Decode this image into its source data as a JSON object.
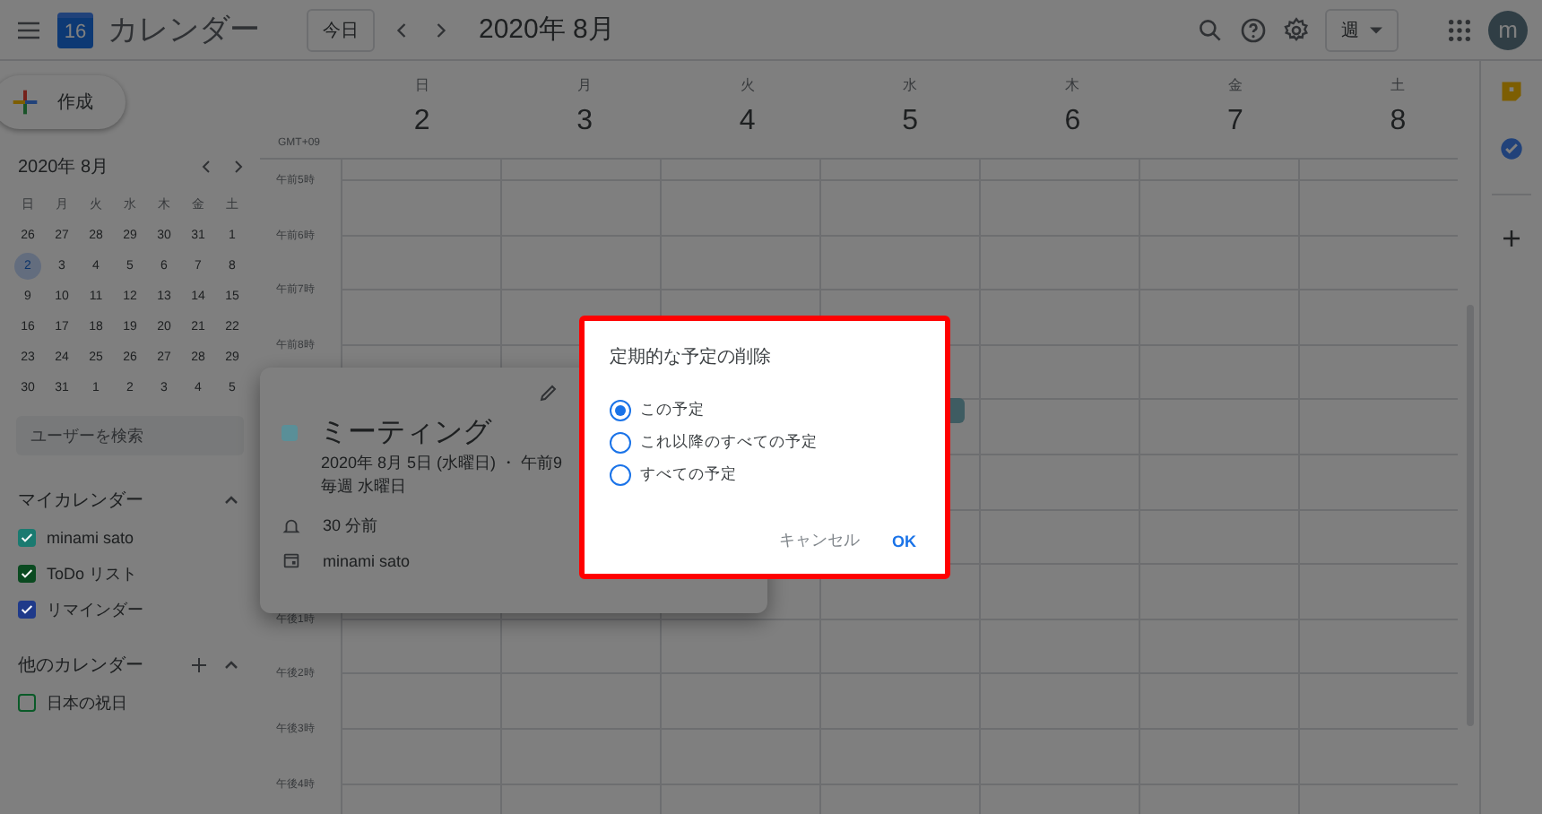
{
  "header": {
    "app_logo_day": "16",
    "app_name": "カレンダー",
    "today_button": "今日",
    "current_period": "2020年 8月",
    "view_selector": "週",
    "avatar_initial": "m"
  },
  "create_button": "作成",
  "mini_calendar": {
    "title": "2020年 8月",
    "weekdays": [
      "日",
      "月",
      "火",
      "水",
      "木",
      "金",
      "土"
    ],
    "weeks": [
      [
        {
          "day": "26",
          "selected": false
        },
        {
          "day": "27",
          "selected": false
        },
        {
          "day": "28",
          "selected": false
        },
        {
          "day": "29",
          "selected": false
        },
        {
          "day": "30",
          "selected": false
        },
        {
          "day": "31",
          "selected": false
        },
        {
          "day": "1",
          "selected": false
        }
      ],
      [
        {
          "day": "2",
          "selected": true
        },
        {
          "day": "3",
          "selected": false
        },
        {
          "day": "4",
          "selected": false
        },
        {
          "day": "5",
          "selected": false
        },
        {
          "day": "6",
          "selected": false
        },
        {
          "day": "7",
          "selected": false
        },
        {
          "day": "8",
          "selected": false
        }
      ],
      [
        {
          "day": "9",
          "selected": false
        },
        {
          "day": "10",
          "selected": false
        },
        {
          "day": "11",
          "selected": false
        },
        {
          "day": "12",
          "selected": false
        },
        {
          "day": "13",
          "selected": false
        },
        {
          "day": "14",
          "selected": false
        },
        {
          "day": "15",
          "selected": false
        }
      ],
      [
        {
          "day": "16",
          "selected": false
        },
        {
          "day": "17",
          "selected": false
        },
        {
          "day": "18",
          "selected": false
        },
        {
          "day": "19",
          "selected": false
        },
        {
          "day": "20",
          "selected": false
        },
        {
          "day": "21",
          "selected": false
        },
        {
          "day": "22",
          "selected": false
        }
      ],
      [
        {
          "day": "23",
          "selected": false
        },
        {
          "day": "24",
          "selected": false
        },
        {
          "day": "25",
          "selected": false
        },
        {
          "day": "26",
          "selected": false
        },
        {
          "day": "27",
          "selected": false
        },
        {
          "day": "28",
          "selected": false
        },
        {
          "day": "29",
          "selected": false
        }
      ],
      [
        {
          "day": "30",
          "selected": false
        },
        {
          "day": "31",
          "selected": false
        },
        {
          "day": "1",
          "selected": false
        },
        {
          "day": "2",
          "selected": false
        },
        {
          "day": "3",
          "selected": false
        },
        {
          "day": "4",
          "selected": false
        },
        {
          "day": "5",
          "selected": false
        }
      ]
    ]
  },
  "people_search": {
    "placeholder": "ユーザーを検索"
  },
  "my_calendars": {
    "title": "マイカレンダー",
    "items": [
      {
        "name": "minami sato",
        "checked": true,
        "color": "#1a7a70"
      },
      {
        "name": "ToDo リスト",
        "checked": true,
        "color": "#0a4a20"
      },
      {
        "name": "リマインダー",
        "checked": true,
        "color": "#1f3a8a"
      }
    ]
  },
  "other_calendars": {
    "title": "他のカレンダー",
    "items": [
      {
        "name": "日本の祝日",
        "checked": false,
        "color": "#0a5a28"
      }
    ]
  },
  "week": {
    "timezone": "GMT+09",
    "days": [
      {
        "weekday": "日",
        "date": "2"
      },
      {
        "weekday": "月",
        "date": "3"
      },
      {
        "weekday": "火",
        "date": "4"
      },
      {
        "weekday": "水",
        "date": "5"
      },
      {
        "weekday": "木",
        "date": "6"
      },
      {
        "weekday": "金",
        "date": "7"
      },
      {
        "weekday": "土",
        "date": "8"
      }
    ],
    "morning_hours": [
      "午前5時",
      "午前6時",
      "午前7時",
      "午前8時"
    ],
    "afternoon_hours": [
      "午後1時",
      "午後2時",
      "午後3時",
      "午後4時"
    ]
  },
  "event_popup": {
    "color": "#5a8f98",
    "title": "ミーティング",
    "date_line": "2020年 8月 5日 (水曜日) ・ 午前9",
    "recurrence": "毎週 水曜日",
    "reminder": "30 分前",
    "calendar": "minami sato"
  },
  "dialog": {
    "title": "定期的な予定の削除",
    "options": [
      {
        "label": "この予定",
        "selected": true
      },
      {
        "label": "これ以降のすべての予定",
        "selected": false
      },
      {
        "label": "すべての予定",
        "selected": false
      }
    ],
    "buttons": [
      {
        "label": "キャンセル",
        "kind": "text"
      },
      {
        "label": "OK",
        "kind": "primary"
      }
    ]
  }
}
